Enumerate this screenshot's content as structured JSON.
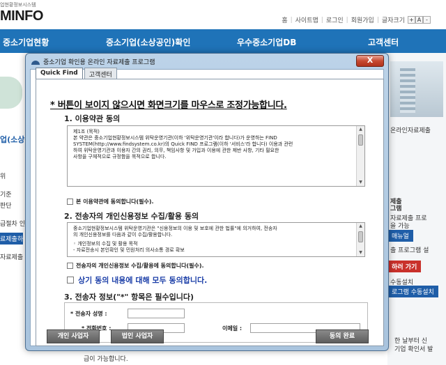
{
  "site": {
    "logo_sub": "업현황정보시스템",
    "logo": "MINFO",
    "util_links": [
      "홈",
      "사이트맵",
      "로그인",
      "회원가입",
      "글자크기"
    ],
    "zoom": [
      "+",
      "A",
      "-"
    ],
    "nav": [
      "중소기업현황",
      "중소기업(소상공인)확인",
      "우수중소기업DB",
      "고객센터"
    ],
    "left_texts": [
      "업(소상공",
      "위",
      "기준",
      "판단",
      "급절차 인",
      "료제출하",
      "자료제출"
    ],
    "right_texts": [
      "온라인자료제출",
      "제출",
      "그램",
      "자료제출 프로",
      "을 가능",
      "매뉴얼",
      "출 프로그램 설",
      "하러 가기",
      "수동설치",
      "로그램 수동설치",
      "한 날부터 신",
      "기업 확인서 발",
      "급이 가능합니다."
    ]
  },
  "dialog": {
    "title": "중소기업 확인용 온라인 자료제출 프로그램",
    "close_label": "X",
    "tabs": [
      "Quick Find",
      "고객센터"
    ],
    "notice": "* 버튼이 보이지 않으시면 화면크기를 마우스로 조정가능합니다.",
    "section1": {
      "title": "1. 이용약관 동의",
      "text_lines": [
        "제1조 (목적)",
        "본 약관은 중소기업현황정보시스템 위탁운영기관(이하 '위탁운영기관'이라 합니다)가 운영하는 FIND",
        "SYSTEM(http://www.findsystem.co.kr)의 Quick FIND 프로그램(이하 '서비스'라 합니다) 이용과 관련",
        "하여 위탁운영기관과 이용자 간의 권리, 의무, 책임사항 및 가입과 이용에 관한 제반 사항, 기타 필요한",
        "사항을 구체적으로 규정함을 목적으로 합니다."
      ],
      "checkbox_label": "본 이용약관에 동의합니다(필수)."
    },
    "section2": {
      "title": "2. 전송자의 개인신용정보 수집/활용 동의",
      "text_lines": [
        "중소기업현황정보시스템 위탁운영기관은 \"신용정보의 이용 및 보호에 관한 법률\"에 의거하여,   전송자",
        "의 개인신용정보를 다음과 같이 수집/활용합니다.",
        "",
        "◦ 개인정보의 수집 및 활용 목적",
        " - 자료전송시 본인확인 및 민원처리 의사소통 경로 확보"
      ],
      "checkbox_label": "전송자의 개인신용정보 수집/활용에 동의합니다(필수)."
    },
    "agree_all": "상기 동의 내용에 대해 모두 동의합니다.",
    "section3": {
      "title": "3. 전송자 정보(\"*\" 항목은 필수입니다)",
      "name_label": "* 전송자 성명 :",
      "phone_label": "* 전화번호 :",
      "email_label": "이메일 :"
    },
    "buttons": {
      "individual": "개인 사업자",
      "corporate": "법인 사업자",
      "agree_complete": "동의 완료"
    }
  }
}
